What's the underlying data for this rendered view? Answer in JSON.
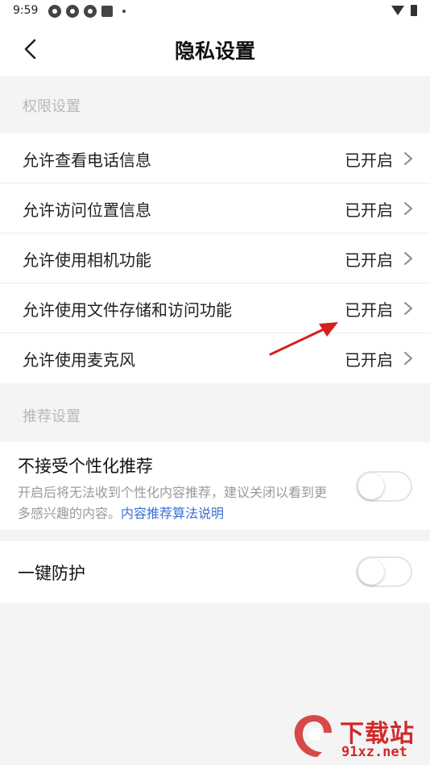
{
  "status_bar": {
    "time": "9:59"
  },
  "header": {
    "title": "隐私设置"
  },
  "sections": {
    "permissions_header": "权限设置",
    "recommend_header": "推荐设置"
  },
  "permissions": [
    {
      "label": "允许查看电话信息",
      "status": "已开启"
    },
    {
      "label": "允许访问位置信息",
      "status": "已开启"
    },
    {
      "label": "允许使用相机功能",
      "status": "已开启"
    },
    {
      "label": "允许使用文件存储和访问功能",
      "status": "已开启"
    },
    {
      "label": "允许使用麦克风",
      "status": "已开启"
    }
  ],
  "recommend": {
    "title": "不接受个性化推荐",
    "description": "开启后将无法收到个性化内容推荐，建议关闭以看到更多感兴趣的内容。",
    "link": "内容推荐算法说明",
    "toggle_on": false
  },
  "guard": {
    "label": "一键防护",
    "toggle_on": false
  },
  "watermark": {
    "text": "下载站",
    "url": "91xz.net"
  },
  "colors": {
    "background": "#f4f4f4",
    "card": "#ffffff",
    "link": "#3a6fd6",
    "annotation_arrow": "#d62020",
    "watermark": "#d12a2a"
  }
}
